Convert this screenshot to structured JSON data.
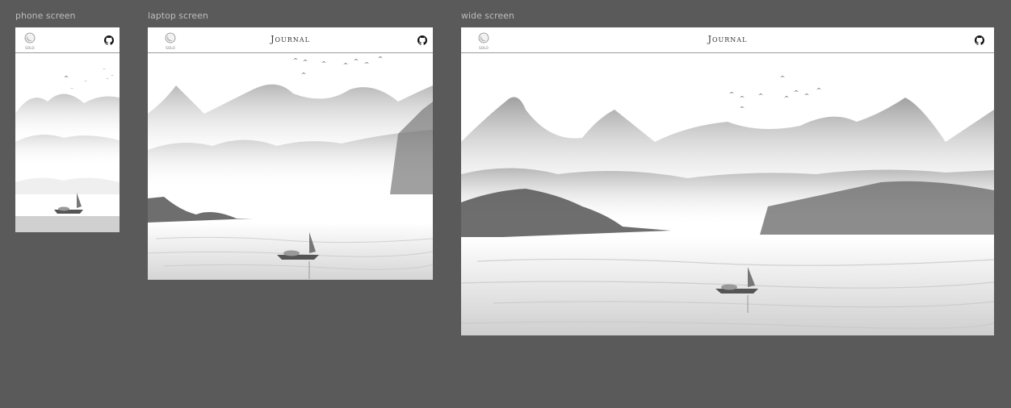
{
  "frames": {
    "phone": {
      "label": "phone screen"
    },
    "laptop": {
      "label": "laptop screen",
      "title": "Journal"
    },
    "wide": {
      "label": "wide screen",
      "title": "Journal"
    }
  },
  "logo_text": "SOLO",
  "icons": {
    "logo": "moon-logo-icon",
    "github": "github-icon",
    "boat": "sailboat-icon",
    "birds": "birds-icon"
  },
  "colors": {
    "background": "#5a5a5a",
    "frame": "#ffffff",
    "ink": "#333333"
  }
}
